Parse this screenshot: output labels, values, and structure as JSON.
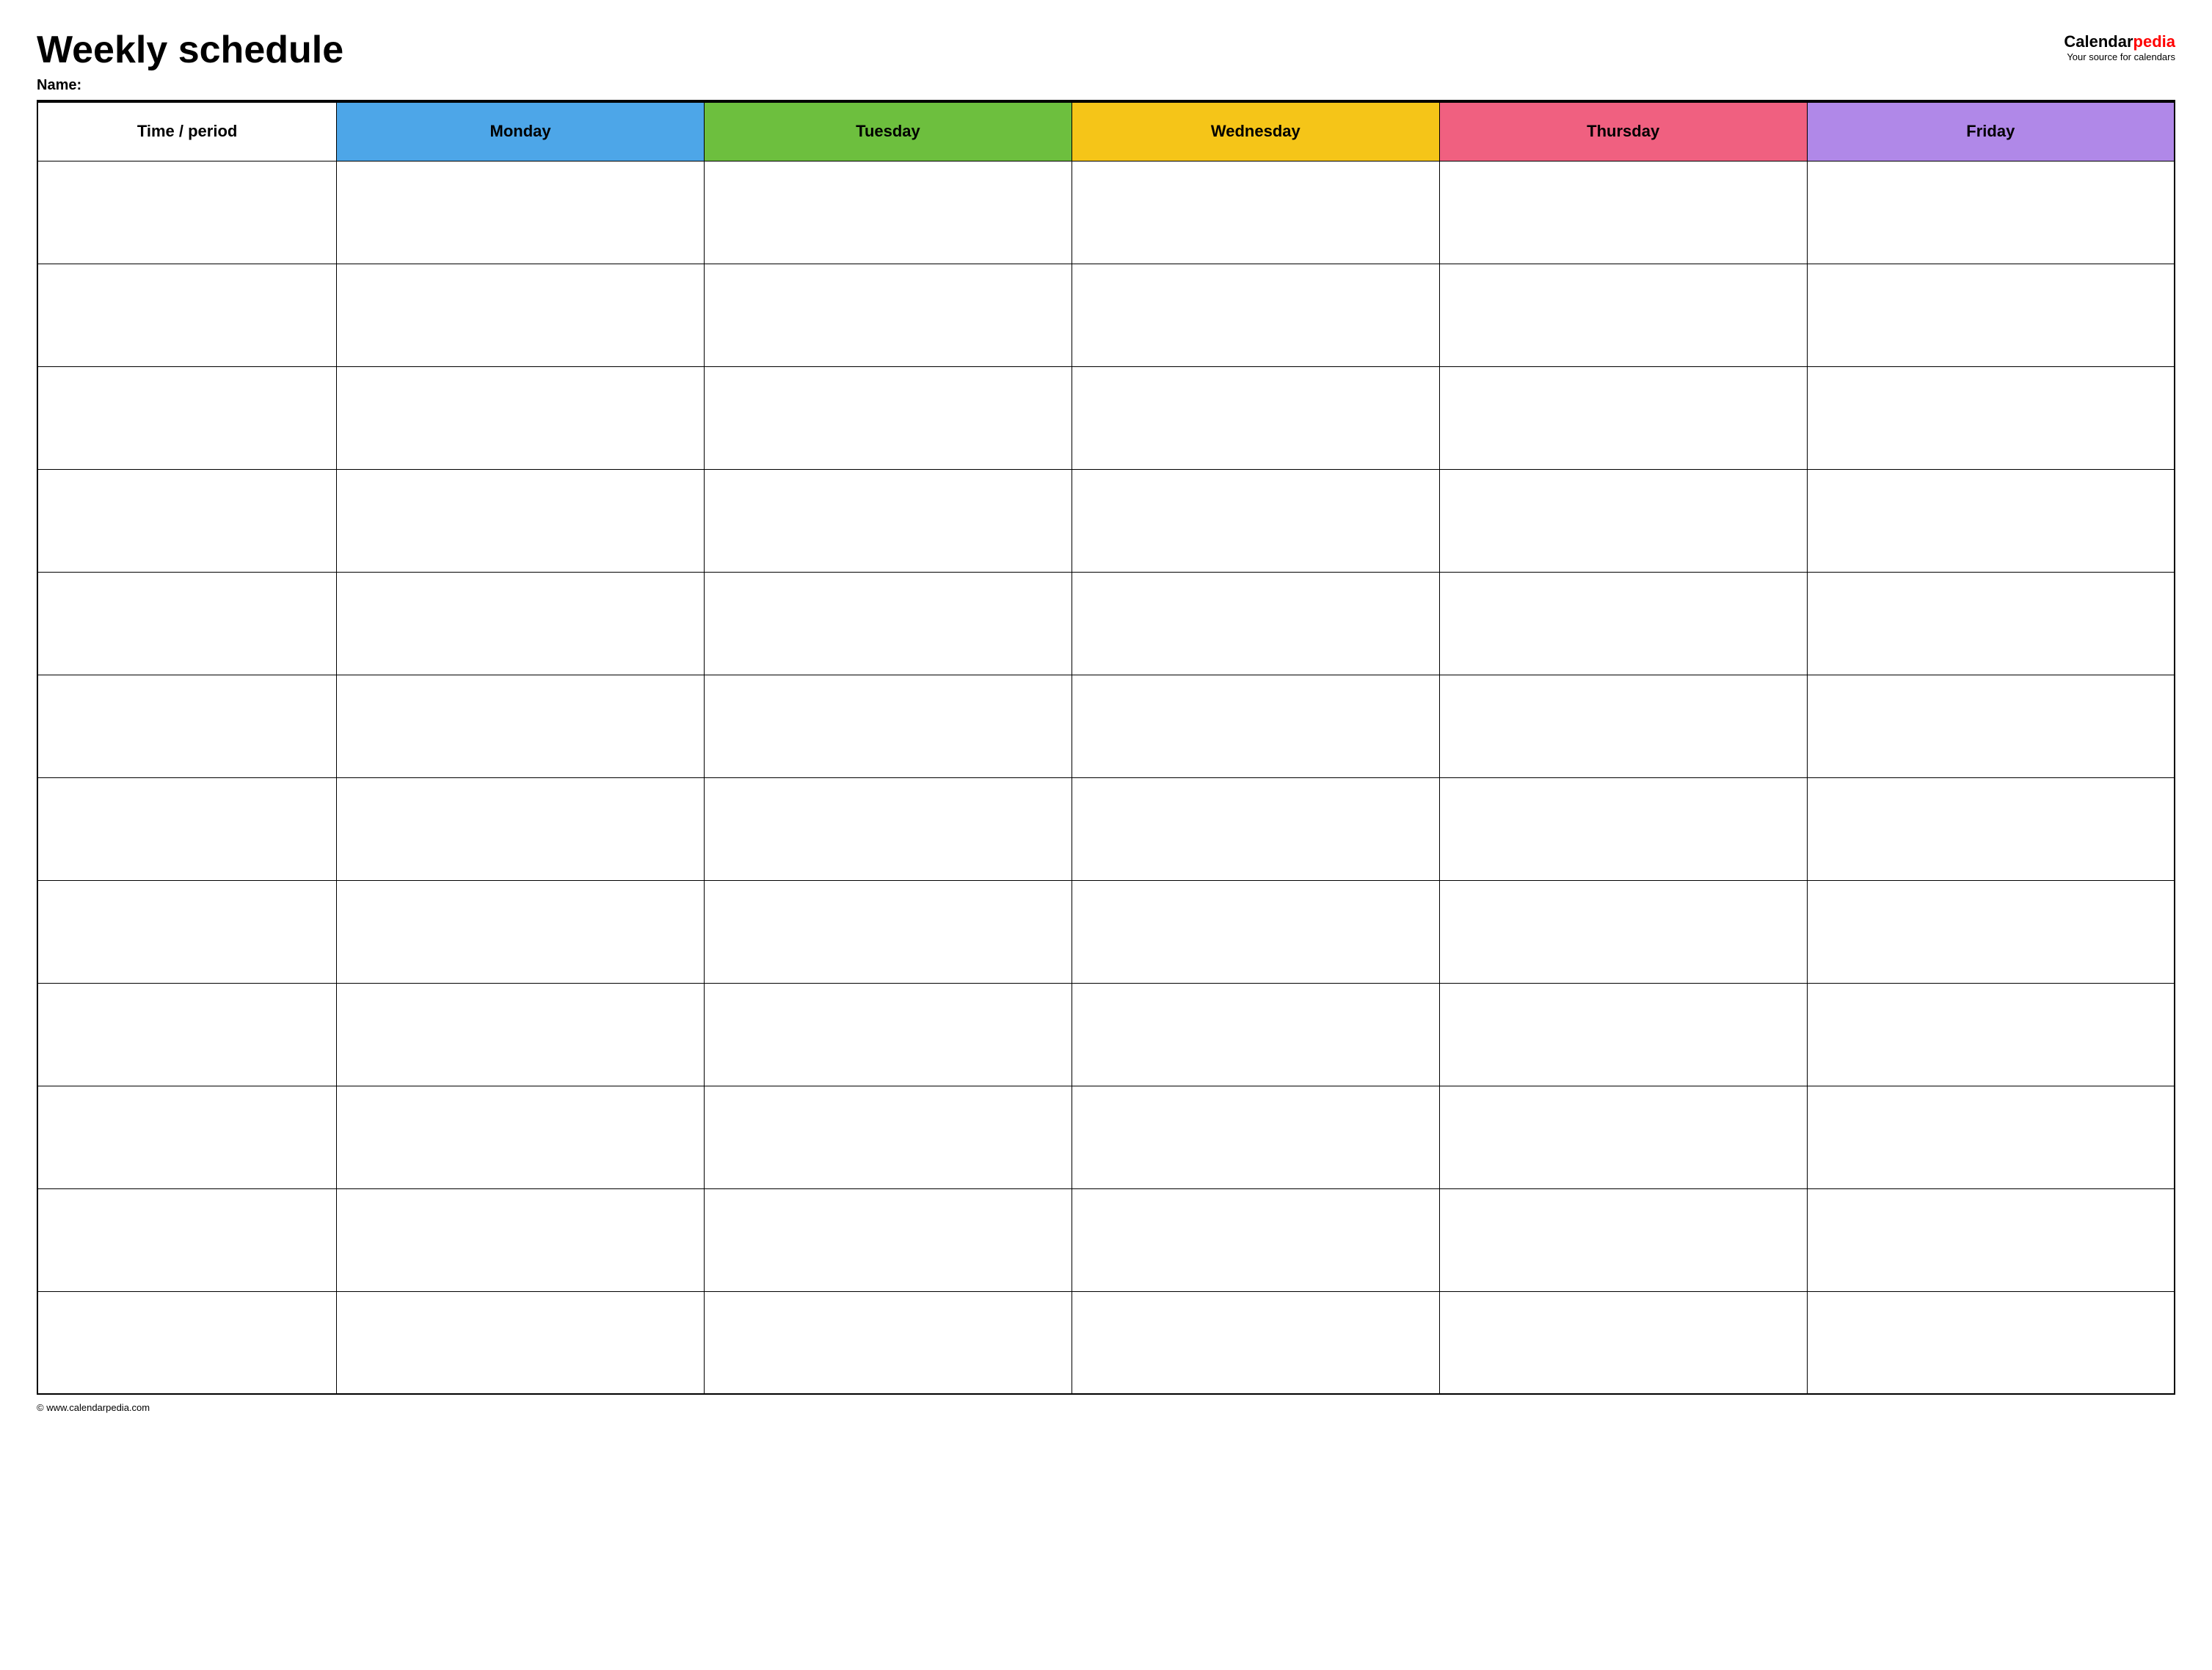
{
  "header": {
    "title": "Weekly schedule",
    "name_label": "Name:",
    "logo": {
      "calendar": "Calendar",
      "pedia": "pedia",
      "tagline": "Your source for calendars"
    }
  },
  "table": {
    "columns": [
      {
        "key": "time",
        "label": "Time / period",
        "color": "#ffffff"
      },
      {
        "key": "monday",
        "label": "Monday",
        "color": "#4da6e8"
      },
      {
        "key": "tuesday",
        "label": "Tuesday",
        "color": "#6dbf3e"
      },
      {
        "key": "wednesday",
        "label": "Wednesday",
        "color": "#f5c518"
      },
      {
        "key": "thursday",
        "label": "Thursday",
        "color": "#f06080"
      },
      {
        "key": "friday",
        "label": "Friday",
        "color": "#b088e8"
      }
    ],
    "row_count": 12
  },
  "footer": {
    "text": "© www.calendarpedia.com"
  }
}
